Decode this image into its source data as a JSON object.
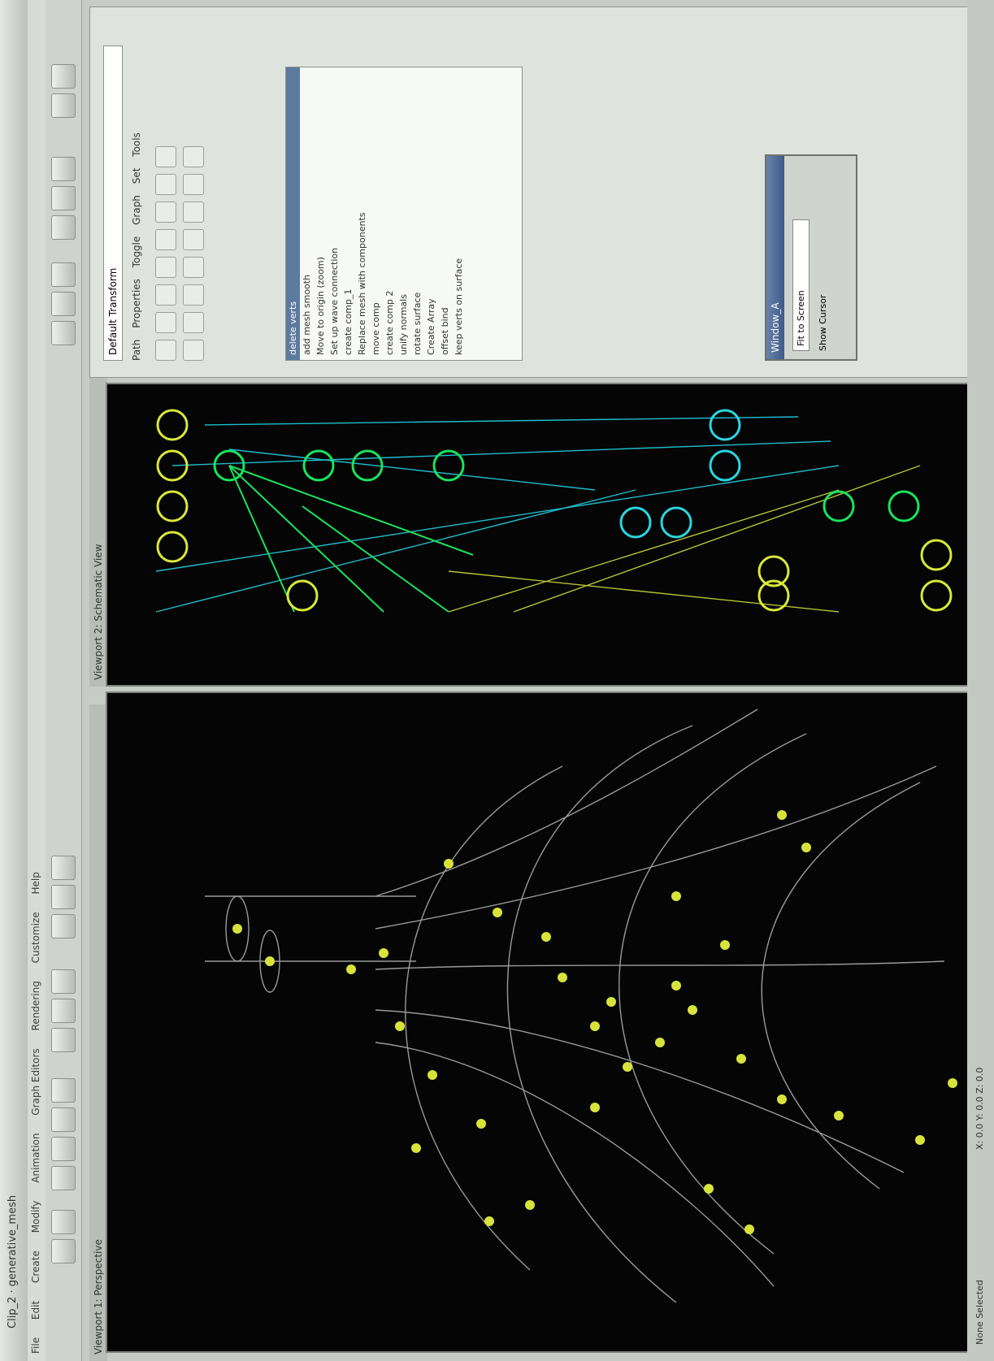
{
  "window": {
    "title": "Clip_2 · generative_mesh"
  },
  "menu": [
    "File",
    "Edit",
    "Create",
    "Modify",
    "Animation",
    "Graph Editors",
    "Rendering",
    "Customize",
    "Help"
  ],
  "viewports": {
    "perspective": {
      "label": "Viewport 1: Perspective"
    },
    "graph": {
      "label": "Viewport 2: Schematic View"
    }
  },
  "history_list": {
    "items": [
      "delete verts",
      "add mesh smooth",
      "Move to origin (zoom)",
      "Set up wave connection",
      "create comp_1",
      "Replace mesh with components",
      "move comp",
      "create comp 2",
      "unify normals",
      "rotate surface",
      "Create Array",
      "offset bind",
      "keep verts on surface"
    ]
  },
  "dialog": {
    "title": "Window_A",
    "field_value": "Fit to Screen",
    "option": "Show Cursor"
  },
  "right_panel": {
    "dropdown": "Default Transform",
    "tabs": [
      "Path",
      "Properties",
      "Toggle",
      "Graph",
      "Set",
      "Tools"
    ]
  },
  "status": {
    "selection": "None Selected",
    "coords": "X: 0.0  Y: 0.0  Z: 0.0"
  },
  "colors": {
    "viewport_bg": "#050505",
    "node_yellow": "#d9e83a",
    "node_green": "#19e35d",
    "node_cyan": "#2ad6e0"
  }
}
